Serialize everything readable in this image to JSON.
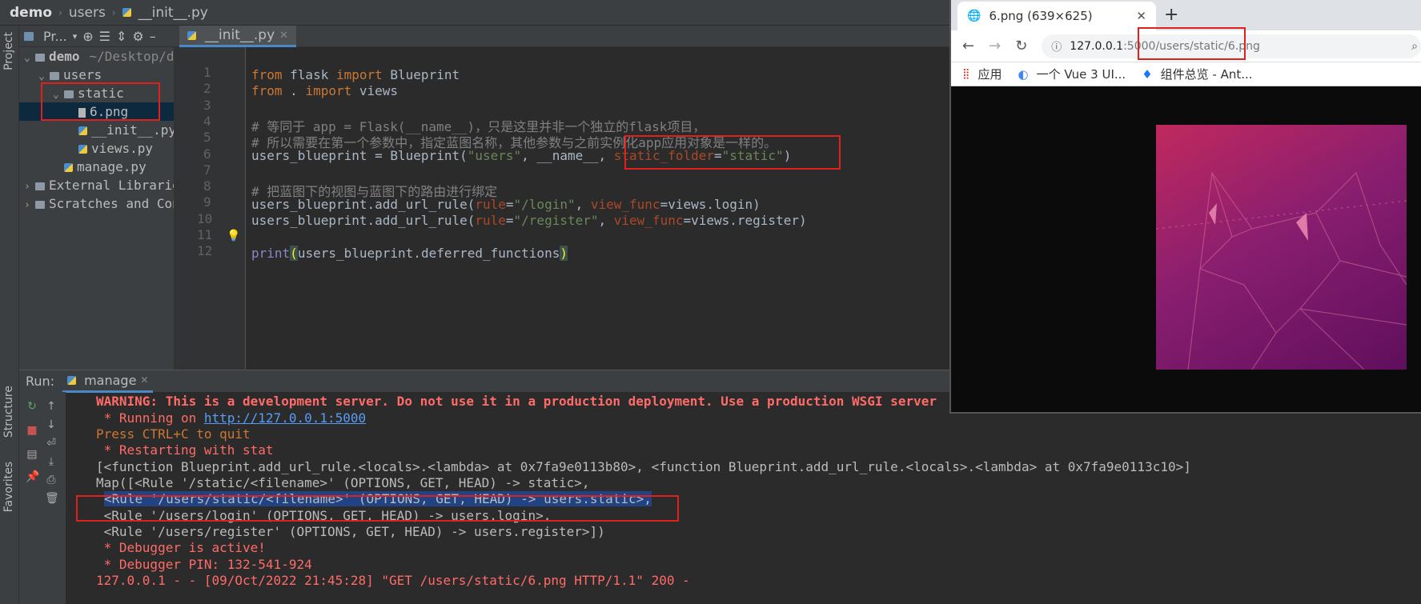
{
  "nav": {
    "project": "demo",
    "folder": "users",
    "file": "__init__.py"
  },
  "sidebar": {
    "project_tab": "Project",
    "structure_tab": "Structure",
    "favorites_tab": "Favorites"
  },
  "project_panel": {
    "title": "Pr...",
    "tree": [
      {
        "label": "demo",
        "suffix": "~/Desktop/de",
        "indent": 0,
        "type": "folder",
        "arrow": "⌄"
      },
      {
        "label": "users",
        "indent": 1,
        "type": "folder",
        "arrow": "⌄"
      },
      {
        "label": "static",
        "indent": 2,
        "type": "folder",
        "arrow": "⌄"
      },
      {
        "label": "6.png",
        "indent": 3,
        "type": "png",
        "arrow": ""
      },
      {
        "label": "__init__.py",
        "indent": 3,
        "type": "py",
        "arrow": ""
      },
      {
        "label": "views.py",
        "indent": 3,
        "type": "py",
        "arrow": ""
      },
      {
        "label": "manage.py",
        "indent": 2,
        "type": "py",
        "arrow": ""
      },
      {
        "label": "External Libraries",
        "indent": 0,
        "type": "lib",
        "arrow": "›"
      },
      {
        "label": "Scratches and Cons",
        "indent": 0,
        "type": "scratch",
        "arrow": "›"
      }
    ]
  },
  "editor": {
    "tab_label": "__init__.py",
    "lines": [
      "1",
      "2",
      "3",
      "4",
      "5",
      "6",
      "7",
      "8",
      "9",
      "10",
      "11",
      "12"
    ]
  },
  "run": {
    "label": "Run:",
    "tab": "manage",
    "console": {
      "warning": "WARNING: This is a development server. Do not use it in a production deployment. Use a production WSGI server",
      "running_prefix": " * Running on ",
      "running_url": "http://127.0.0.1:5000",
      "quit": "Press CTRL+C to quit",
      "restart": " * Restarting with stat",
      "functions": "[<function Blueprint.add_url_rule.<locals>.<lambda> at 0x7fa9e0113b80>, <function Blueprint.add_url_rule.<locals>.<lambda> at 0x7fa9e0113c10>]",
      "map": "Map([<Rule '/static/<filename>' (OPTIONS, GET, HEAD) -> static>,",
      "rule_static": "<Rule '/users/static/<filename>' (OPTIONS, GET, HEAD) -> users.static>,",
      "rule_login": " <Rule '/users/login' (OPTIONS, GET, HEAD) -> users.login>,",
      "rule_register": " <Rule '/users/register' (OPTIONS, GET, HEAD) -> users.register>])",
      "debugger": " * Debugger is active!",
      "pin": " * Debugger PIN: 132-541-924",
      "request": "127.0.0.1 - - [09/Oct/2022 21:45:28] \"GET /users/static/6.png HTTP/1.1\" 200 -"
    }
  },
  "browser": {
    "tab_title": "6.png (639×625)",
    "url_host": "127.0.0.1",
    "url_port": ":5000",
    "url_path": "/users/static/6.png",
    "bookmarks": [
      "应用",
      "一个 Vue 3 UI...",
      "组件总览 - Ant..."
    ]
  }
}
